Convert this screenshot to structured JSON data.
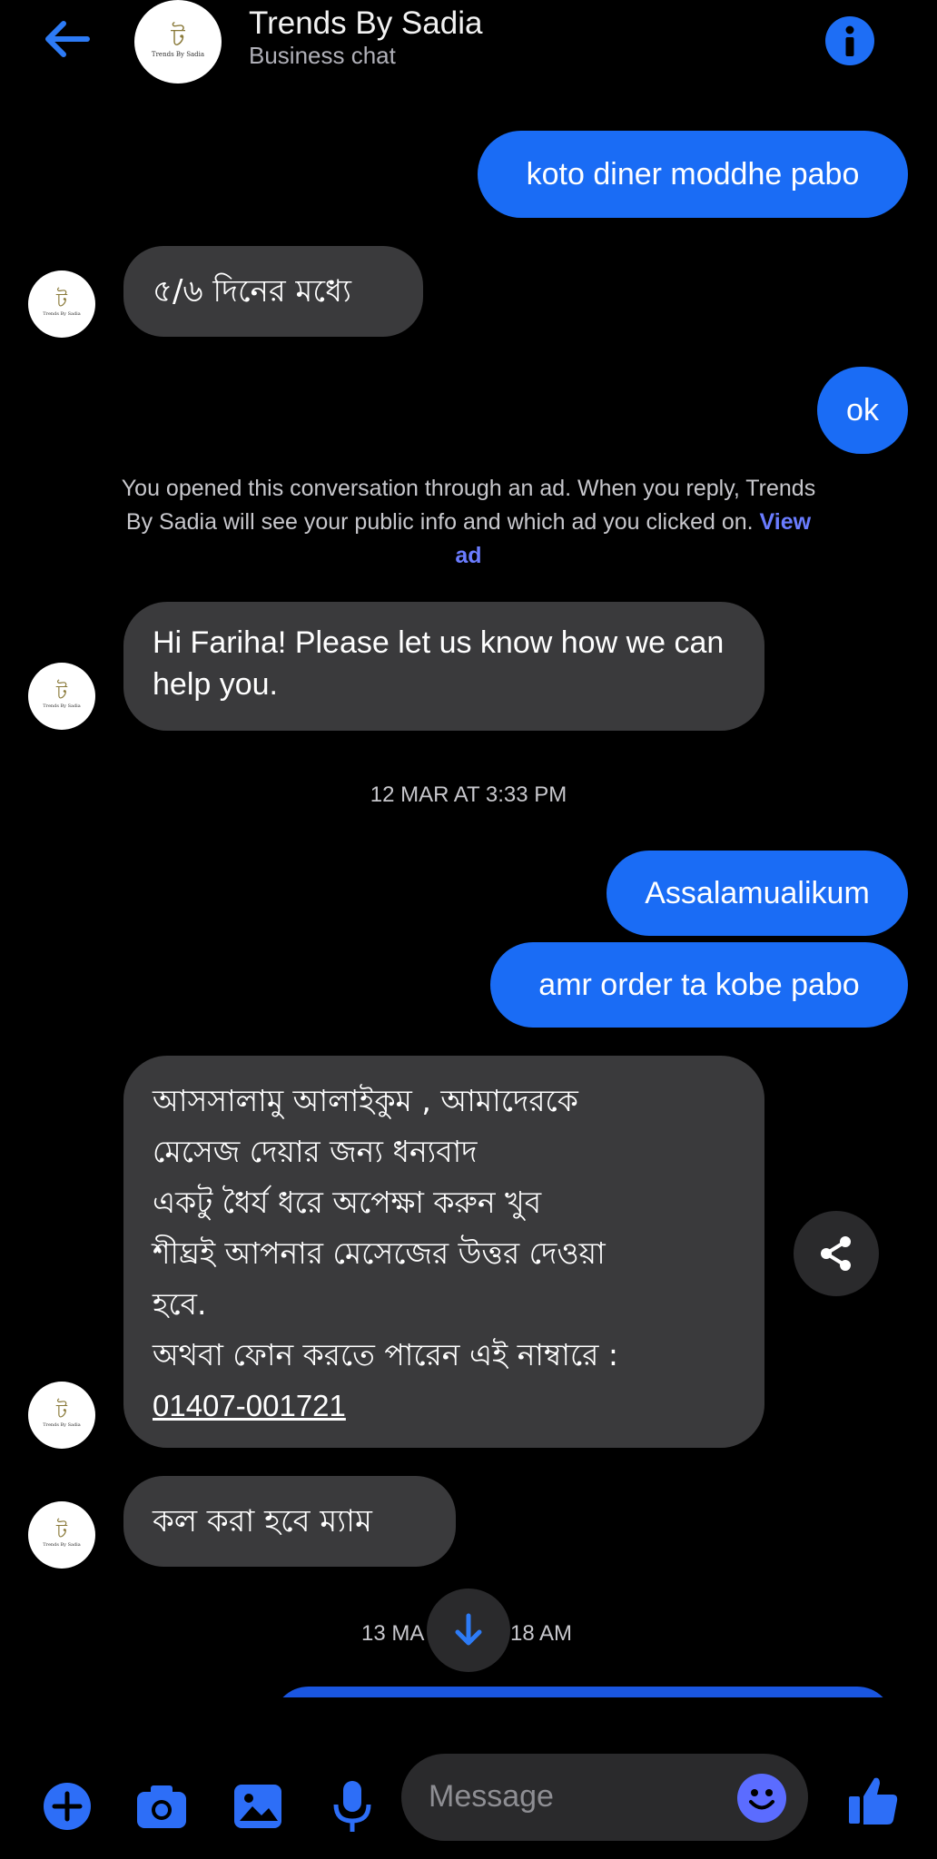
{
  "header": {
    "title": "Trends By Sadia",
    "subtitle": "Business chat",
    "logo_glyph": "ট",
    "logo_text": "Trends By Sadia"
  },
  "messages": [
    {
      "dir": "out",
      "text": "koto diner moddhe pabo"
    },
    {
      "dir": "in",
      "text": "৫/৬ দিনের মধ্যে"
    },
    {
      "dir": "out",
      "text": "ok"
    },
    {
      "dir": "in",
      "text": "Hi Fariha! Please let us know how we can help you."
    },
    {
      "dir": "out",
      "text": "Assalamualikum"
    },
    {
      "dir": "out",
      "text": "amr order ta kobe pabo"
    },
    {
      "dir": "in",
      "lines": [
        "আসসালামু আলাইকুম , আমাদেরকে",
        "মেসেজ দেয়ার জন্য ধন্যবাদ",
        "একটু ধৈর্য ধরে অপেক্ষা করুন খুব",
        "শীঘ্রই আপনার মেসেজের উত্তর দেওয়া",
        "হবে.",
        "অথবা ফোন করতে পারেন এই নাম্বারে :"
      ],
      "phone": "01407-001721"
    },
    {
      "dir": "in",
      "text": "কল করা হবে ম্যাম"
    }
  ],
  "notice": {
    "text": "You opened this conversation through an ad. When you reply, Trends By Sadia will see your public info and which ad you clicked on.",
    "link": "View ad"
  },
  "timestamps": [
    "12 MAR AT 3:33 PM",
    "13 MA",
    "18 AM"
  ],
  "composer": {
    "placeholder": "Message"
  },
  "icons": [
    "back-arrow-icon",
    "info-icon",
    "share-icon",
    "arrow-down-icon",
    "plus-icon",
    "camera-icon",
    "gallery-icon",
    "microphone-icon",
    "emoji-icon",
    "thumbs-up-icon"
  ],
  "colors": {
    "accent": "#1a6cf5",
    "incoming_bubble": "#3a3a3c",
    "link": "#6a7cff"
  }
}
